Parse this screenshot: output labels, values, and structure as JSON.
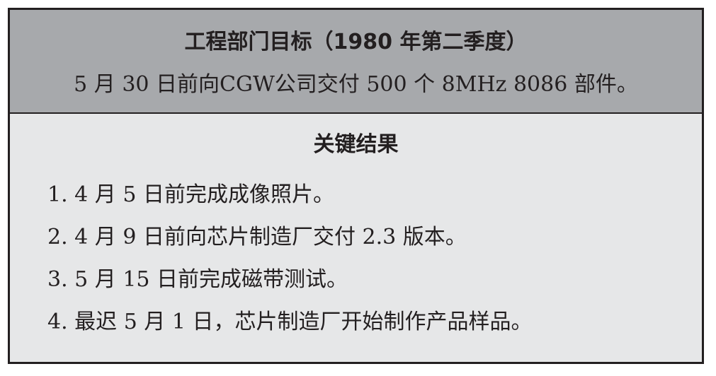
{
  "objective": {
    "title": "工程部门目标（1980 年第二季度）",
    "text": "5 月 30 日前向CGW公司交付 500 个 8MHz 8086 部件。"
  },
  "key_results": {
    "title": "关键结果",
    "items": [
      "1. 4 月 5 日前完成成像照片。",
      "2. 4 月 9 日前向芯片制造厂交付 2.3 版本。",
      "3. 5 月 15 日前完成磁带测试。",
      "4. 最迟 5 月 1 日，芯片制造厂开始制作产品样品。"
    ]
  },
  "colors": {
    "objective_background": "#a7a9ac",
    "results_background": "#e6e7e8",
    "border": "#231f20",
    "text": "#231f20"
  }
}
